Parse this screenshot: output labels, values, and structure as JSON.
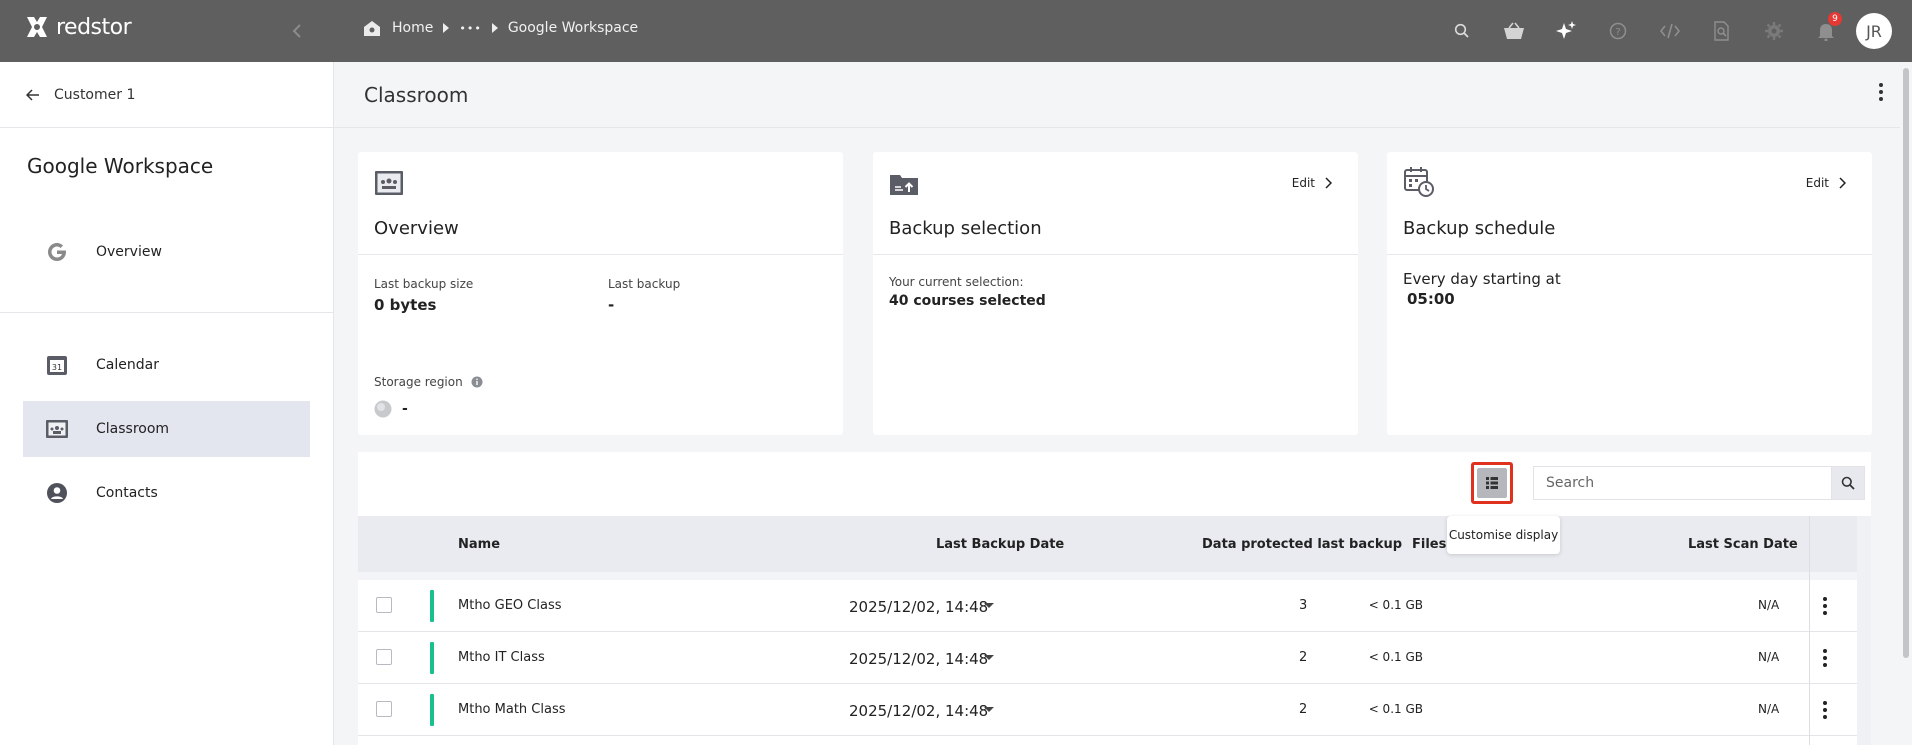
{
  "topbar": {
    "brand": "redstor",
    "breadcrumb": {
      "home": "Home",
      "ellipsis": "•••",
      "current": "Google Workspace"
    },
    "icons": [
      "search-icon",
      "basket-icon",
      "sparkle-icon",
      "help-icon",
      "code-icon",
      "file-search-icon",
      "gear-icon",
      "bell-icon"
    ],
    "notification_count": "9",
    "avatar_initials": "JR"
  },
  "sidebar": {
    "back_label": "Customer 1",
    "section_title": "Google Workspace",
    "items": [
      {
        "label": "Overview",
        "icon": "google-icon"
      },
      {
        "label": "Calendar",
        "icon": "calendar-icon"
      },
      {
        "label": "Classroom",
        "icon": "classroom-icon",
        "active": true
      },
      {
        "label": "Contacts",
        "icon": "contact-icon"
      }
    ]
  },
  "main": {
    "title": "Classroom",
    "cards": {
      "overview": {
        "title": "Overview",
        "last_backup_size_label": "Last backup size",
        "last_backup_size": "0 bytes",
        "last_backup_label": "Last backup",
        "last_backup": "-",
        "storage_region_label": "Storage region",
        "storage_region": "-"
      },
      "selection": {
        "title": "Backup selection",
        "edit": "Edit",
        "current_label": "Your current selection:",
        "current_value": "40 courses selected"
      },
      "schedule": {
        "title": "Backup schedule",
        "edit": "Edit",
        "line1": "Every day starting at",
        "time": "05:00"
      }
    },
    "table": {
      "customise_tooltip": "Customise display",
      "search_placeholder": "Search",
      "columns": {
        "name": "Name",
        "last_backup_date": "Last Backup Date",
        "data_protected": "Data protected last backup",
        "files": "Files s",
        "last_scan": "Last Scan Date"
      },
      "rows": [
        {
          "name": "Mtho GEO Class",
          "date": "2025/12/02, 14:48",
          "data": "< 0.1 GB",
          "files": "3",
          "scan": "N/A"
        },
        {
          "name": "Mtho IT Class",
          "date": "2025/12/02, 14:48",
          "data": "< 0.1 GB",
          "files": "2",
          "scan": "N/A"
        },
        {
          "name": "Mtho Math Class",
          "date": "2025/12/02, 14:48",
          "data": "< 0.1 GB",
          "files": "2",
          "scan": "N/A"
        }
      ]
    }
  },
  "colors": {
    "topbar": "#5f5f5f",
    "active_nav": "#e3e6ef",
    "status_bar": "#1bbf8e",
    "highlight": "#e0301e"
  }
}
